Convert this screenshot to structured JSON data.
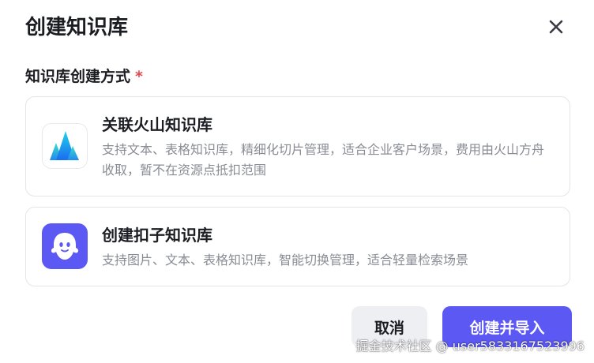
{
  "dialog": {
    "title": "创建知识库",
    "close_icon": "close-icon"
  },
  "method": {
    "label": "知识库创建方式",
    "required_mark": "*",
    "options": [
      {
        "icon": "volcano-mountain-icon",
        "title": "关联火山知识库",
        "description": "支持文本、表格知识库，精细化切片管理，适合企业客户场景，费用由火山方舟收取，暂不在资源点抵扣范围"
      },
      {
        "icon": "coze-ghost-icon",
        "title": "创建扣子知识库",
        "description": "支持图片、文本、表格知识库，智能切换管理，适合轻量检索场景"
      }
    ]
  },
  "footer": {
    "cancel_label": "取消",
    "primary_label": "创建并导入"
  },
  "watermark": "掘金技术社区 @ user5833167523996",
  "colors": {
    "accent": "#5b58f3",
    "required": "#e5484d",
    "text_secondary": "#8a8c95",
    "border": "#e4e5ea"
  }
}
